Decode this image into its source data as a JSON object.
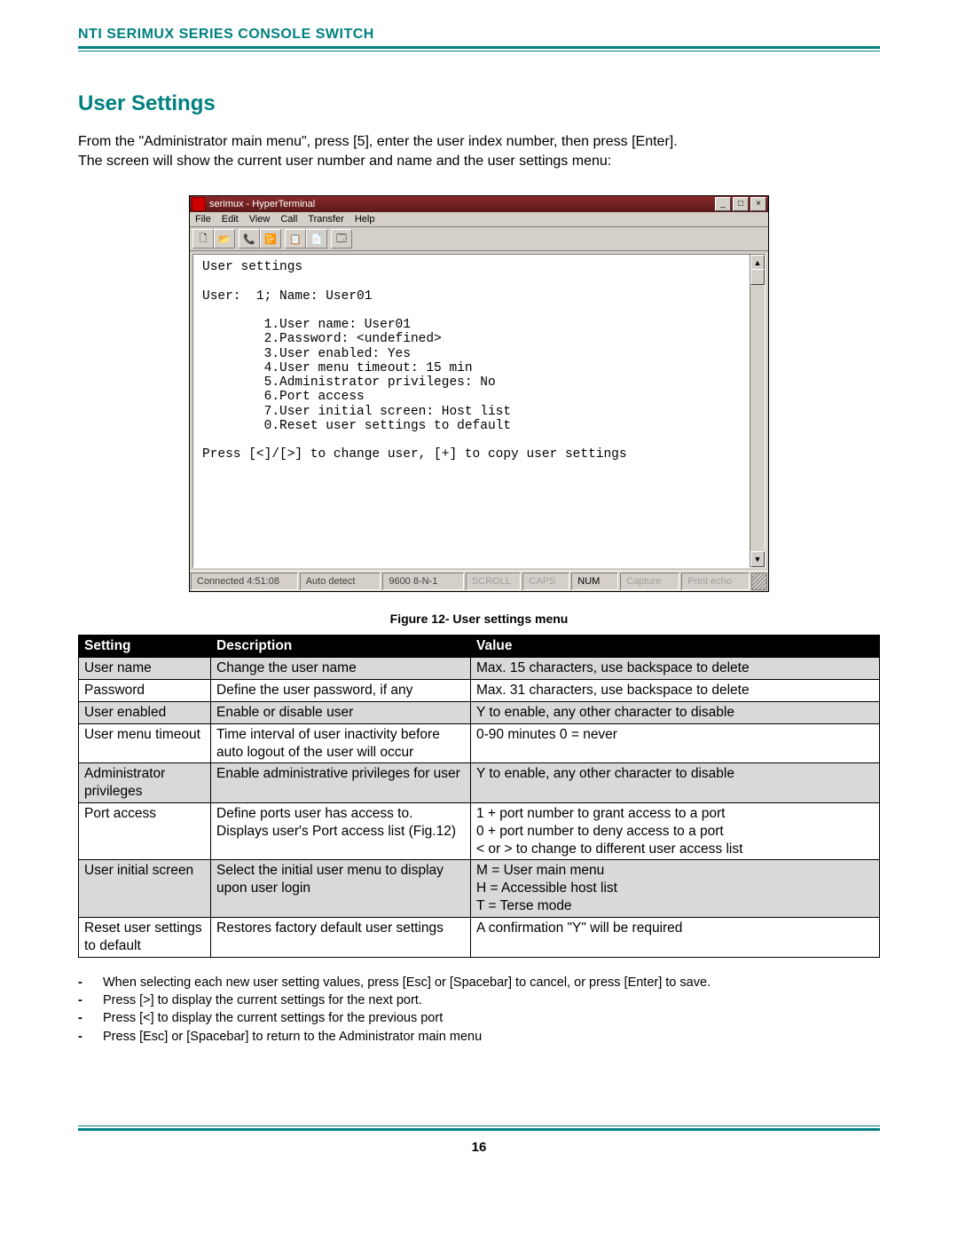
{
  "header": {
    "title": "NTI SERIMUX SERIES CONSOLE SWITCH"
  },
  "section": {
    "title": "User Settings"
  },
  "intro": {
    "line1": "From the \"Administrator main menu\", press [5], enter the user index number, then press [Enter].",
    "line2": "The screen will show the current user number and name and the user settings menu:"
  },
  "hyperterm": {
    "title": "serimux - HyperTerminal",
    "menus": [
      "File",
      "Edit",
      "View",
      "Call",
      "Transfer",
      "Help"
    ],
    "win_min": "_",
    "win_max": "□",
    "win_close": "×",
    "tool_icons": [
      "🗋",
      "📂",
      "",
      "📞",
      "📴",
      "",
      "📋",
      "📄",
      "",
      "🗔"
    ],
    "terminal": "User settings\n\nUser:  1; Name: User01\n\n        1.User name: User01\n        2.Password: <undefined>\n        3.User enabled: Yes\n        4.User menu timeout: 15 min\n        5.Administrator privileges: No\n        6.Port access\n        7.User initial screen: Host list\n        0.Reset user settings to default\n\nPress [<]/[>] to change user, [+] to copy user settings",
    "scroll_up": "▲",
    "scroll_down": "▼",
    "status": {
      "connected": "Connected 4:51:08",
      "detect": "Auto detect",
      "proto": "9600 8-N-1",
      "scroll": "SCROLL",
      "caps": "CAPS",
      "num": "NUM",
      "capture": "Capture",
      "printecho": "Print echo"
    }
  },
  "figure_caption": "Figure 12- User settings menu",
  "table": {
    "headers": [
      "Setting",
      "Description",
      "Value"
    ],
    "rows": [
      {
        "shade": "gray",
        "setting": "User name",
        "desc": "Change the user name",
        "value": "Max. 15 characters, use backspace to delete"
      },
      {
        "shade": "white",
        "setting": "Password",
        "desc": "Define the user password, if any",
        "value": "Max. 31 characters, use backspace to delete"
      },
      {
        "shade": "gray",
        "setting": "User enabled",
        "desc": "Enable or disable user",
        "value": "Y to enable, any other character to disable"
      },
      {
        "shade": "white",
        "setting": "User menu timeout",
        "desc": "Time interval of user inactivity before auto logout of the user will occur",
        "value": "0-90 minutes   0 = never"
      },
      {
        "shade": "gray",
        "setting": "Administrator privileges",
        "desc": "Enable administrative privileges for user",
        "value": "Y to enable, any other character to disable"
      },
      {
        "shade": "white",
        "setting": "Port access",
        "desc": "Define ports user has access to.  Displays user's Port access list (Fig.12)",
        "value": "1 + port number to grant access to a port\n0 + port number to deny access to a port\n< or > to change to different user access list"
      },
      {
        "shade": "gray",
        "setting": "User initial screen",
        "desc": "Select the initial user menu to display upon user login",
        "value": "M = User main menu\nH = Accessible host list\nT = Terse mode"
      },
      {
        "shade": "white",
        "setting": "Reset user settings to default",
        "desc": "Restores factory default user settings",
        "value": "A confirmation \"Y\"  will be required"
      }
    ]
  },
  "notes": [
    "When selecting each new user setting values,  press [Esc] or [Spacebar] to cancel,   or press [Enter] to save.",
    "Press [>] to display the current settings for the next port.",
    "Press [<] to display the current settings for the previous port",
    "Press [Esc] or [Spacebar] to return to the Administrator main menu"
  ],
  "page_number": "16"
}
